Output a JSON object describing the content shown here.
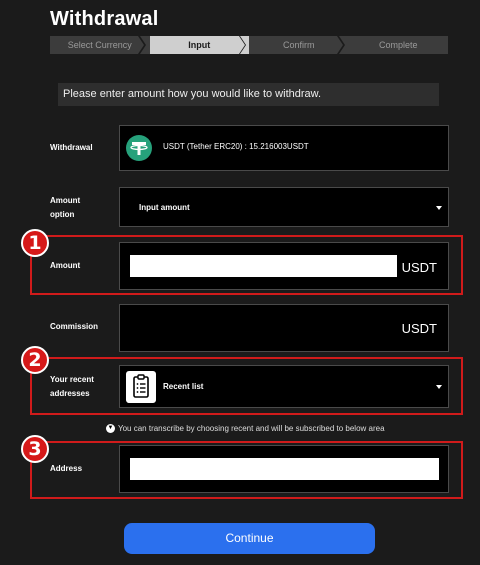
{
  "page": {
    "title": "Withdrawal"
  },
  "steps": [
    {
      "label": "Select Currency",
      "state": "done"
    },
    {
      "label": "Input",
      "state": "active"
    },
    {
      "label": "Confirm",
      "state": "todo"
    },
    {
      "label": "Complete",
      "state": "todo"
    }
  ],
  "notice": "Please enter amount how you would like to withdraw.",
  "withdrawal": {
    "label": "Withdrawal",
    "currency_text": "USDT (Tether ERC20) : 15.216003USDT",
    "icon": "tether-icon"
  },
  "amount_option": {
    "label": "Amount option",
    "selected": "Input amount"
  },
  "amount": {
    "label": "Amount",
    "value": "",
    "unit": "USDT",
    "badge": "1"
  },
  "commission": {
    "label": "Commission",
    "unit": "USDT"
  },
  "recent": {
    "label": "Your recent addresses",
    "selected": "Recent list",
    "badge": "2",
    "icon": "clipboard-list-icon"
  },
  "hint": "You can transcribe by choosing recent and will be subscribed to below area",
  "address": {
    "label": "Address",
    "value": "",
    "badge": "3"
  },
  "continue_label": "Continue",
  "colors": {
    "accent": "#2b70ee",
    "highlight": "#d01b1b",
    "tether": "#26a17b"
  }
}
